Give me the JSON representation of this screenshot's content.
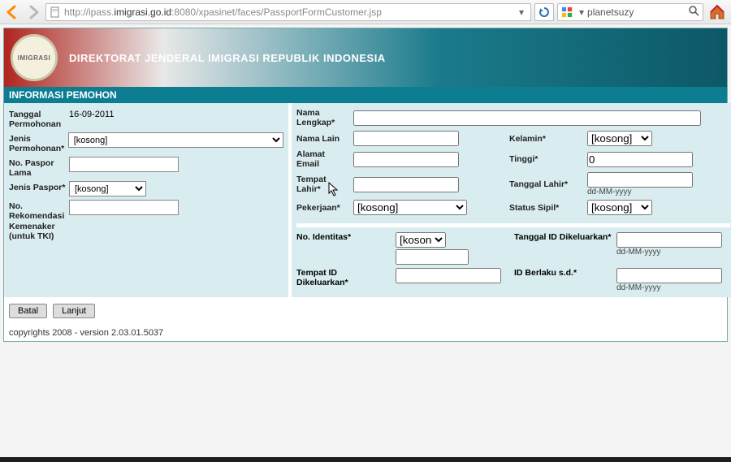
{
  "browser": {
    "url_prefix": "http://ipass.",
    "url_host": "imigrasi.go.id",
    "url_suffix": ":8080/xpasinet/faces/PassportFormCustomer.jsp",
    "search": "planetsuzy"
  },
  "banner": {
    "title": "DIREKTORAT JENDERAL IMIGRASI REPUBLIK INDONESIA"
  },
  "section": {
    "title": "INFORMASI PEMOHON"
  },
  "left": {
    "tgl_label": "Tanggal Permohonan",
    "tgl_value": "16-09-2011",
    "jenis_label": "Jenis Permohonan*",
    "jenis_value": "[kosong]",
    "paspor_lama_label": "No. Paspor Lama",
    "paspor_lama_value": "",
    "jenis_paspor_label": "Jenis Paspor*",
    "jenis_paspor_value": "[kosong]",
    "rekom_label": "No. Rekomendasi Kemenaker (untuk TKI)",
    "rekom_value": ""
  },
  "right": {
    "nama_lengkap_label": "Nama Lengkap*",
    "nama_lengkap": "",
    "nama_lain_label": "Nama Lain",
    "nama_lain": "",
    "kelamin_label": "Kelamin*",
    "kelamin": "[kosong]",
    "email_label": "Alamat Email",
    "email": "",
    "tinggi_label": "Tinggi*",
    "tinggi": "0",
    "tempat_lahir_label": "Tempat Lahir*",
    "tempat_lahir": "",
    "tgl_lahir_label": "Tanggal Lahir*",
    "tgl_lahir": "",
    "tgl_lahir_hint": "dd-MM-yyyy",
    "pekerjaan_label": "Pekerjaan*",
    "pekerjaan": "[kosong]",
    "status_label": "Status Sipil*",
    "status": "[kosong]"
  },
  "id": {
    "no_label": "No. Identitas*",
    "no_type": "[kosong]",
    "no_value": "",
    "tgl_keluar_label": "Tanggal ID Dikeluarkan*",
    "tgl_keluar": "",
    "tgl_keluar_hint": "dd-MM-yyyy",
    "tempat_keluar_label": "Tempat ID Dikeluarkan*",
    "tempat_keluar": "",
    "berlaku_label": "ID Berlaku s.d.*",
    "berlaku": "",
    "berlaku_hint": "dd-MM-yyyy"
  },
  "buttons": {
    "batal": "Batal",
    "lanjut": "Lanjut"
  },
  "footer": "copyrights 2008 - version 2.03.01.5037"
}
